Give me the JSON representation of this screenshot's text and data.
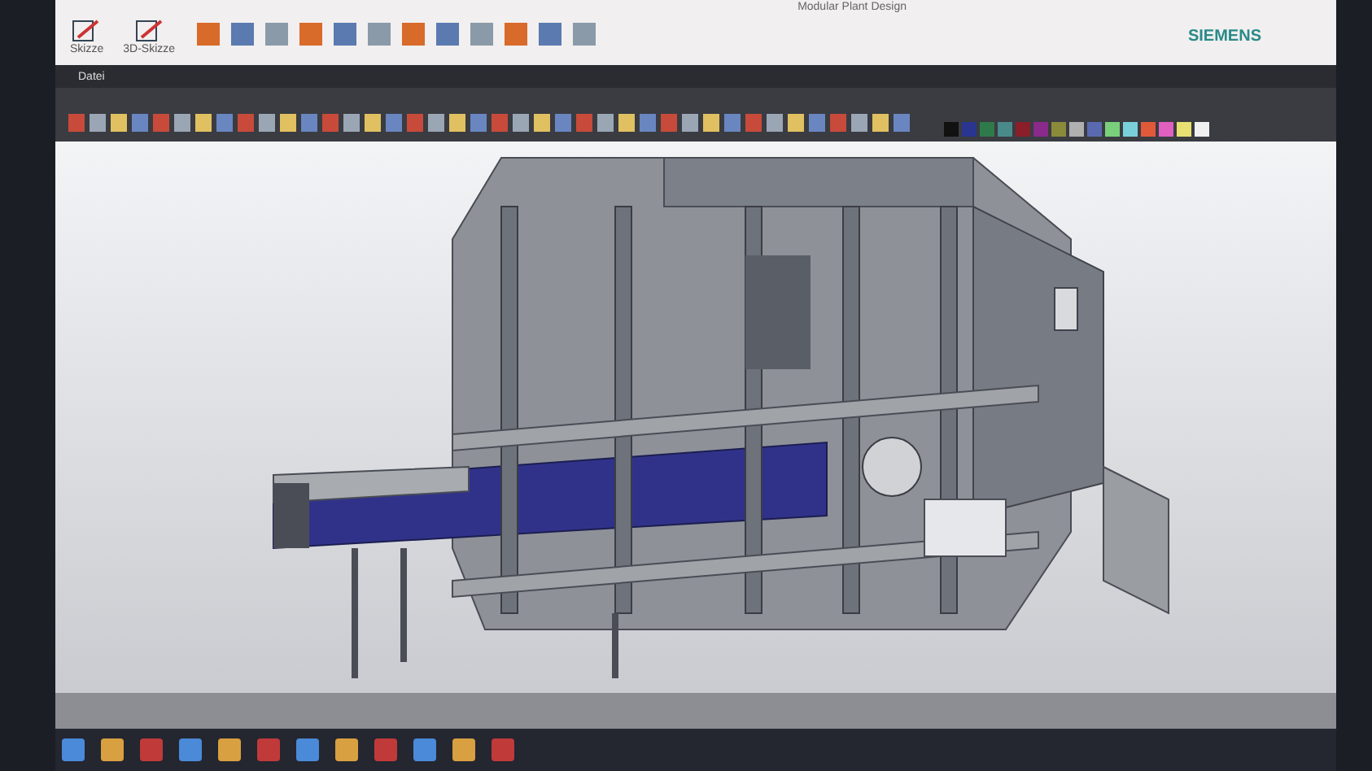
{
  "ribbon": {
    "tabs": [
      {
        "label": "Modular Plant Design",
        "selected": false
      }
    ],
    "buttons": [
      {
        "label": "Skizze"
      },
      {
        "label": "3D-Skizze"
      }
    ],
    "brand": "SIEMENS"
  },
  "menu_bar": {
    "items": [
      {
        "label": "Datei",
        "selected": false
      }
    ]
  },
  "palette": [
    {
      "color": "#111111"
    },
    {
      "color": "#2a3590"
    },
    {
      "color": "#2f7a4a"
    },
    {
      "color": "#4a8a8a"
    },
    {
      "color": "#8a1f2a"
    },
    {
      "color": "#8a2a8a"
    },
    {
      "color": "#8a8a3a"
    },
    {
      "color": "#b0b0b0"
    },
    {
      "color": "#5a6ab0"
    },
    {
      "color": "#7ad07a"
    },
    {
      "color": "#7ad0d8"
    },
    {
      "color": "#e05a3a"
    },
    {
      "color": "#e060c0"
    },
    {
      "color": "#e8e070"
    },
    {
      "color": "#f0f0f0"
    }
  ]
}
